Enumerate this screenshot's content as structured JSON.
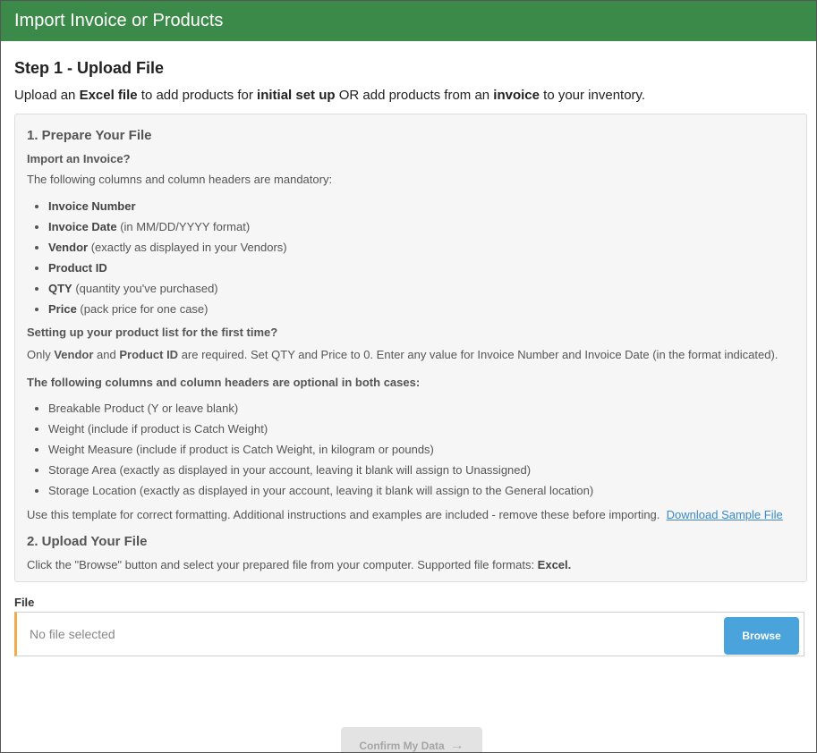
{
  "window": {
    "title": "Import Invoice or Products"
  },
  "step": {
    "title": "Step 1 - Upload File"
  },
  "intro": {
    "t1": "Upload an ",
    "b1": "Excel file",
    "t2": " to add products for ",
    "b2": "initial set up",
    "t3": " OR add products from an ",
    "b3": "invoice",
    "t4": " to your inventory."
  },
  "prepare": {
    "heading": "1. Prepare Your File",
    "import_q": "Import an Invoice?",
    "mandatory_text": "The following columns and column headers are mandatory:",
    "mandatory": [
      {
        "name": "Invoice Number",
        "note": ""
      },
      {
        "name": "Invoice Date",
        "note": " (in MM/DD/YYYY format)"
      },
      {
        "name": "Vendor",
        "note": " (exactly as displayed in your Vendors)"
      },
      {
        "name": "Product ID",
        "note": ""
      },
      {
        "name": "QTY",
        "note": " (quantity you've purchased)"
      },
      {
        "name": "Price",
        "note": " (pack price for one case)"
      }
    ],
    "setup_q": "Setting up your product list for the first time?",
    "setup": {
      "t1": "Only ",
      "b1": "Vendor",
      "t2": " and ",
      "b2": "Product ID",
      "t3": " are required. Set QTY and Price to 0. Enter any value for Invoice Number and Invoice Date (in the format indicated)."
    },
    "optional_heading": "The following columns and column headers are optional in both cases:",
    "optional": [
      "Breakable Product (Y or leave blank)",
      "Weight (include if product is Catch Weight)",
      "Weight Measure (include if product is Catch Weight, in kilogram or pounds)",
      "Storage Area (exactly as displayed in your account, leaving it blank will assign to Unassigned)",
      "Storage Location (exactly as displayed in your account, leaving it blank will assign to the General location)"
    ],
    "template_text": "Use this template for correct formatting. Additional instructions and examples are included - remove these before importing.  ",
    "download_link": "Download Sample File"
  },
  "upload": {
    "heading": "2. Upload Your File",
    "text": "Click the \"Browse\" button and select your prepared file from your computer. Supported file formats: ",
    "formats": "Excel."
  },
  "file": {
    "label": "File",
    "placeholder": "No file selected",
    "browse_label": "Browse"
  },
  "confirm": {
    "label": "Confirm My Data",
    "arrow": "→"
  }
}
